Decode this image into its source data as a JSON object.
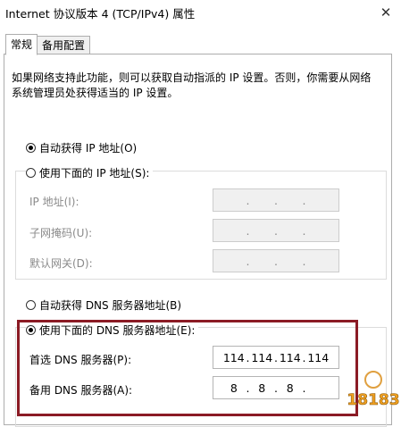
{
  "window": {
    "title": "Internet 协议版本 4 (TCP/IPv4) 属性"
  },
  "tabs": [
    {
      "label": "常规"
    },
    {
      "label": "备用配置"
    }
  ],
  "description": "如果网络支持此功能，则可以获取自动指派的 IP 设置。否则，你需要从网络系统管理员处获得适当的 IP 设置。",
  "ip_settings": {
    "auto_label": "自动获得 IP 地址(O)",
    "manual_label": "使用下面的 IP 地址(S):",
    "fields": [
      {
        "label": "IP 地址(I):",
        "value": [
          " ",
          " ",
          " ",
          " "
        ]
      },
      {
        "label": "子网掩码(U):",
        "value": [
          " ",
          " ",
          " ",
          " "
        ]
      },
      {
        "label": "默认网关(D):",
        "value": [
          " ",
          " ",
          " ",
          " "
        ]
      }
    ]
  },
  "dns_settings": {
    "auto_label": "自动获得 DNS 服务器地址(B)",
    "manual_label": "使用下面的 DNS 服务器地址(E):",
    "preferred": {
      "label": "首选 DNS 服务器(P):",
      "value": [
        "114",
        "114",
        "114",
        "114"
      ]
    },
    "alternate": {
      "label": "备用 DNS 服务器(A):",
      "value": [
        "8",
        "8",
        "8",
        ""
      ]
    }
  },
  "watermark": {
    "text": "18183"
  },
  "colors": {
    "highlight": "#8b1b25",
    "watermark": "#f0a020"
  },
  "icons": {
    "close": "close-icon"
  }
}
